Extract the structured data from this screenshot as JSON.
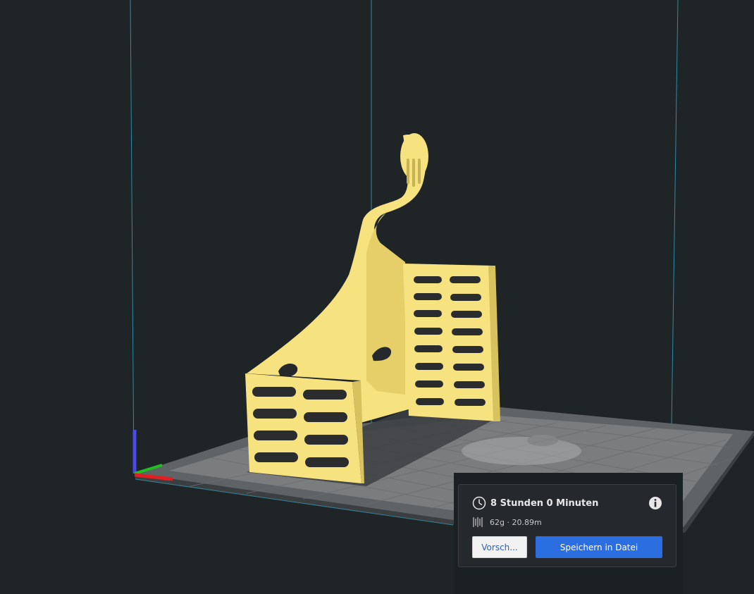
{
  "print_summary": {
    "time": "8 Stunden 0 Minuten",
    "material": "62g · 20.89m",
    "preview_label": "Vorsch...",
    "save_label": "Speichern in Datei"
  },
  "icons": {
    "clock": "clock-icon",
    "info": "info-icon",
    "spool": "filament-spool-icon"
  },
  "colors": {
    "background": "#1f2427",
    "model": "#f6e27e",
    "model_shadow": "#d8c25e",
    "build_plate": "#6e6e6e",
    "build_volume_lines": "#3aa3c0",
    "accent_button": "#2a6ee0",
    "axis_x": "#e02020",
    "axis_y": "#20c020",
    "axis_z": "#4a4ae8"
  }
}
